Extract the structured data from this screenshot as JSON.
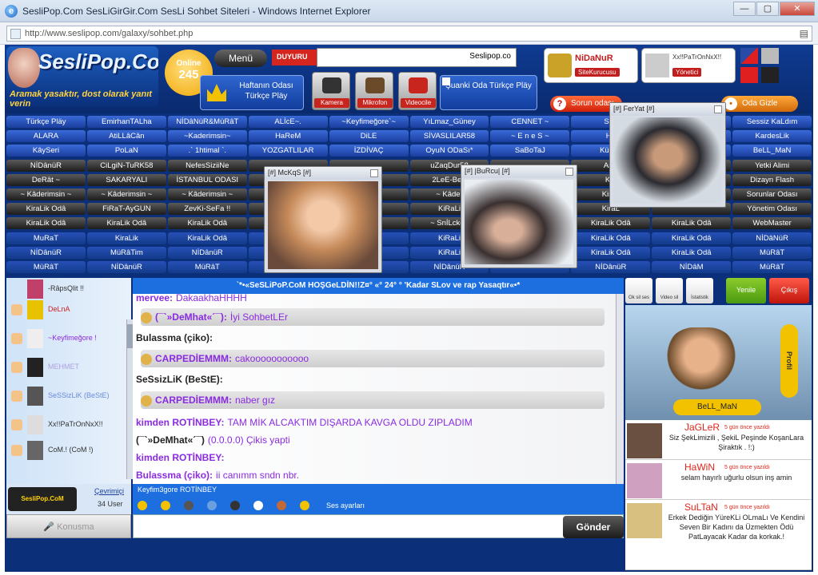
{
  "window": {
    "title": "SesliPop.Com SesLiGirGir.Com SesLi Sohbet Siteleri - Windows Internet Explorer",
    "url": "http://www.seslipop.com/galaxy/sohbet.php"
  },
  "header": {
    "logo": "SesliPop.CoM",
    "slogan": "Aramak yasaktır, dost olarak yanıt verin",
    "online_label": "Online",
    "online_count": "245",
    "menu": "Menü",
    "duyuru": "DUYURU",
    "ticker": "Seslipop.co",
    "hafta": "Haftanın Odası Türkçe Pläy",
    "camera": "Kamera",
    "mic": "Mikrofon",
    "video": "Videocile",
    "suanki": "Şuanki Oda Türkçe Pläy",
    "admin1_name": "NiDaNuR",
    "admin1_role": "SiteKurucusu",
    "admin2_name": "Xx!!PaTrOnNxX!!",
    "admin2_role": "Yönetici",
    "sorun": "Sorun odası",
    "odagizle": "Oda Gizle"
  },
  "rooms": [
    [
      "Türkçe Pläy",
      "EmirhanTALha",
      "NİDâNüR&MüRâT",
      "ALİcE~.",
      "~Keyfimeğore`~",
      "YıLmaz_Güney",
      "CENNET ~",
      "Sad",
      "",
      "Sessiz KaLdım"
    ],
    [
      "ALARA",
      "AtiLLâCân",
      "~Kaderimsin~",
      "HaReM",
      "DiLE",
      "SİVASLILAR58",
      "~ E n e S ~",
      "Ha",
      "",
      "KardesLik"
    ],
    [
      "KâySeri",
      "PoLaN",
      ".` 1htimal `.",
      "YOZGATLILAR",
      "İZDİVAÇ",
      "OyuN ODaSı*",
      "SaBoTaJ",
      "Kürtce",
      "",
      "BeLL_MaN"
    ],
    [
      "NİDânüR",
      "CiLgiN-TuRK58",
      "NefesSiziiNe",
      "",
      "",
      "uZaqDur58",
      "",
      "Aski",
      "",
      "Yetki Alimi"
    ],
    [
      "DeRât ~",
      "SAKARYALI",
      "İSTANBUL ODASI",
      "",
      "",
      "2LeE-BeB",
      "",
      "KQ",
      "",
      "Dizayn Flash"
    ],
    [
      "~ Kâderimsin ~",
      "~ Kâderimsin ~",
      "~ Kâderimsin ~",
      "",
      "",
      "~ Kâder",
      "",
      "KiraL",
      "",
      "Sorunlar Odası"
    ],
    [
      "KiraLik Odâ",
      "FiRaT-AyGUN",
      "ZevKi-SeFa !!",
      "",
      "",
      "KiRaLi",
      "",
      "KiraL",
      "",
      "Yönetim Odası"
    ],
    [
      "KiraLik Odâ",
      "KiraLik Odâ",
      "KiraLik Odâ",
      "",
      "",
      "~ SnİLcken",
      "",
      "KiraLik Odâ",
      "KiraLik Odâ",
      "WebMaster"
    ],
    [
      "MuRaT",
      "KiraLik",
      "KiraLik Odâ",
      "",
      "",
      "KiRaLi",
      "",
      "KiraLik Odâ",
      "KiraLik Odâ",
      "NİDâNüR"
    ],
    [
      "NİDânüR",
      "MüRâTim",
      "NİDânüR",
      "",
      "",
      "KiRaLi",
      "",
      "KiraLik Odâ",
      "KiraLik Odâ",
      "MüRâT"
    ],
    [
      "MüRâT",
      "NİDânüR",
      "MüRâT",
      "",
      "",
      "NİDânüR",
      "",
      "NİDânüR",
      "NİDâM",
      "MüRâT"
    ]
  ],
  "cams": [
    {
      "title": "[#] McKqS [#]"
    },
    {
      "title": "[#] |BuRcu| [#]"
    },
    {
      "title": "[#] FerYat [#]"
    }
  ],
  "users": [
    {
      "name": "-RâpsQlit !!"
    },
    {
      "name": "DeLnA"
    },
    {
      "name": "~Keyfimeğore !"
    },
    {
      "name": "MEHMET"
    },
    {
      "name": "SeSSizLiK (BeStE)"
    },
    {
      "name": "Xx!!PaTrOnNxX!!"
    },
    {
      "name": "CoM.! (CoM !)"
    }
  ],
  "counter": {
    "badge": "SesliPop.CoM",
    "online_link": "Çevrimiçi",
    "count": "34 User"
  },
  "konusma": "Konusma",
  "chat": {
    "header": "`*•«SeSLiPoP.CoM  HOŞGeLDİN!!Z¤° «° 24° ° 'Kadar SLov ve rap Yasaqtır«•*",
    "messages": [
      {
        "user": "mervee:",
        "text": "DakaakhaHHHH",
        "color": "#8a2be2"
      },
      {
        "user": "(¯`»DeMhat«´¯):",
        "text": "İyi SohbetLEr",
        "color": "#8a2be2"
      },
      {
        "user": "Bulassma (çiko):",
        "text": "",
        "color": "#222"
      },
      {
        "user": "CARPEDİEMMM:",
        "text": "cakooooooooooo",
        "color": "#8a2be2"
      },
      {
        "user": "SeSsizLiK (BeStE):",
        "text": "",
        "color": "#222"
      },
      {
        "user": "CARPEDİEMMM:",
        "text": "naber gız",
        "color": "#8a2be2"
      },
      {
        "user": "kimden ROTİNBEY:",
        "text": "TAM MİK ALCAKTIM DIŞARDA KAVGA OLDU ZIPLADIM",
        "color": "#8a2be2"
      },
      {
        "user": "(¯`»DeMhat«´¯)",
        "text": "(0.0.0.0) Çikis yapti",
        "color": "#222"
      },
      {
        "user": "kimden ROTİNBEY:",
        "text": "",
        "color": "#8a2be2"
      },
      {
        "user": "Bulassma (çiko):",
        "text": "ii canımm sndn nbr.",
        "color": "#8a2be2"
      }
    ],
    "typing": "Keyfim3gore   ROTİNBEY",
    "sound": "Ses ayarları",
    "send": "Gönder"
  },
  "right": {
    "btn1": "Ok sil ses",
    "btn2": "Video sil",
    "btn3": "İstatistik",
    "yenile": "Yenile",
    "cikis": "Çıkış",
    "profile_name": "BeLL_MaN",
    "profile_tag": "Profil",
    "posts": [
      {
        "name": "JaGLeR",
        "date": "5 gün önce yazıldı",
        "text": "Siz ŞekLimizili , ŞekiL Peşinde KoşanLara Şiraktık . !:)"
      },
      {
        "name": "HaWiN",
        "date": "5 gün önce yazıldı",
        "text": "selam hayırlı uğurlu olsun inş amin"
      },
      {
        "name": "SuLTaN",
        "date": "5 gün önce yazıldı",
        "text": "Erkek Dediğin YüreKLi OLmaLı Ve Kendini Seven Bir Kadını da Üzmekten Ödü PatLayacak Kadar da korkak.!"
      }
    ]
  }
}
